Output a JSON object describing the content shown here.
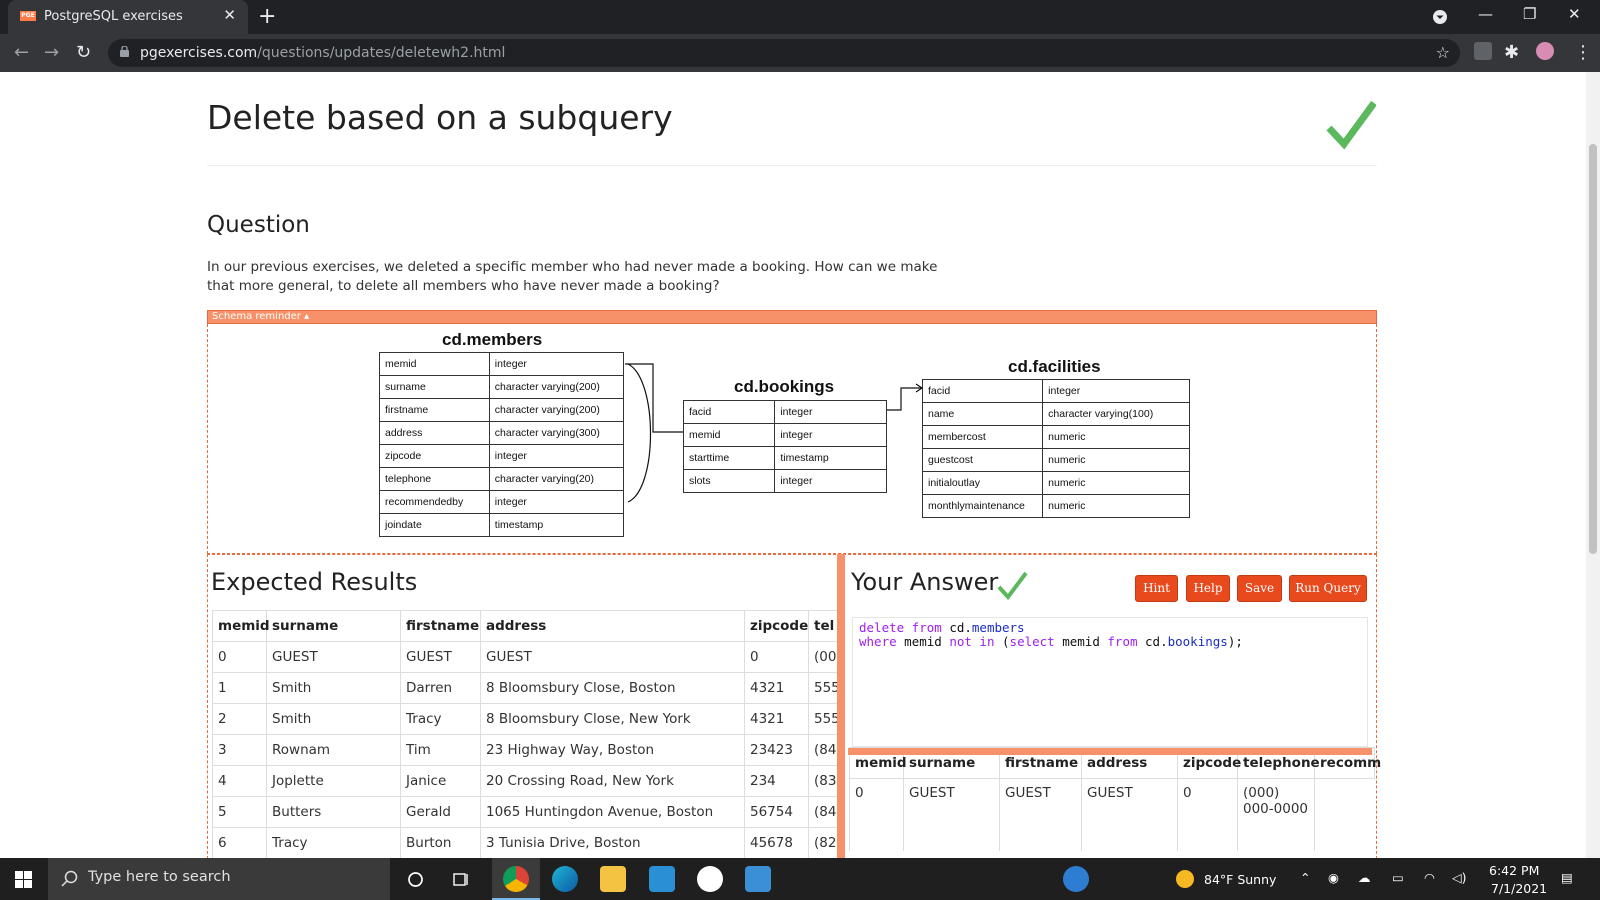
{
  "browser": {
    "tab_title": "PostgreSQL exercises",
    "favicon_text": "PGE",
    "url_domain": "pgexercises.com",
    "url_path": "/questions/updates/deletewh2.html"
  },
  "page": {
    "title": "Delete based on a subquery",
    "question_heading": "Question",
    "question_text": "In our previous exercises, we deleted a specific member who had never made a booking. How can we make that more general, to delete all members who have never made a booking?",
    "schema_toggle": "Schema reminder ▴"
  },
  "schema": {
    "members": {
      "title": "cd.members",
      "rows": [
        [
          "memid",
          "integer"
        ],
        [
          "surname",
          "character varying(200)"
        ],
        [
          "firstname",
          "character varying(200)"
        ],
        [
          "address",
          "character varying(300)"
        ],
        [
          "zipcode",
          "integer"
        ],
        [
          "telephone",
          "character varying(20)"
        ],
        [
          "recommendedby",
          "integer"
        ],
        [
          "joindate",
          "timestamp"
        ]
      ]
    },
    "bookings": {
      "title": "cd.bookings",
      "rows": [
        [
          "facid",
          "integer"
        ],
        [
          "memid",
          "integer"
        ],
        [
          "starttime",
          "timestamp"
        ],
        [
          "slots",
          "integer"
        ]
      ]
    },
    "facilities": {
      "title": "cd.facilities",
      "rows": [
        [
          "facid",
          "integer"
        ],
        [
          "name",
          "character varying(100)"
        ],
        [
          "membercost",
          "numeric"
        ],
        [
          "guestcost",
          "numeric"
        ],
        [
          "initialoutlay",
          "numeric"
        ],
        [
          "monthlymaintenance",
          "numeric"
        ]
      ]
    }
  },
  "expected": {
    "heading": "Expected Results",
    "columns": [
      "memid",
      "surname",
      "firstname",
      "address",
      "zipcode",
      "tel"
    ],
    "rows": [
      [
        "0",
        "GUEST",
        "GUEST",
        "GUEST",
        "0",
        "(00"
      ],
      [
        "1",
        "Smith",
        "Darren",
        "8 Bloomsbury Close, Boston",
        "4321",
        "555"
      ],
      [
        "2",
        "Smith",
        "Tracy",
        "8 Bloomsbury Close, New York",
        "4321",
        "555"
      ],
      [
        "3",
        "Rownam",
        "Tim",
        "23 Highway Way, Boston",
        "23423",
        "(84"
      ],
      [
        "4",
        "Joplette",
        "Janice",
        "20 Crossing Road, New York",
        "234",
        "(83"
      ],
      [
        "5",
        "Butters",
        "Gerald",
        "1065 Huntingdon Avenue, Boston",
        "56754",
        "(84"
      ],
      [
        "6",
        "Tracy",
        "Burton",
        "3 Tunisia Drive, Boston",
        "45678",
        "(82"
      ]
    ]
  },
  "answer": {
    "heading": "Your Answer",
    "buttons": {
      "hint": "Hint",
      "help": "Help",
      "save": "Save",
      "run": "Run Query"
    },
    "code": {
      "l1_kw1": "delete from",
      "l1_t1": " cd.",
      "l1_tbl": "members",
      "l2_kw1": "where",
      "l2_t1": " memid ",
      "l2_kw2": "not in",
      "l2_t2": " (",
      "l2_kw3": "select",
      "l2_t3": " memid ",
      "l2_kw4": "from",
      "l2_t4": " cd.",
      "l2_tbl": "bookings",
      "l2_t5": ");"
    },
    "columns": [
      "memid",
      "surname",
      "firstname",
      "address",
      "zipcode",
      "telephone",
      "recomm"
    ],
    "rows": [
      [
        "0",
        "GUEST",
        "GUEST",
        "GUEST",
        "0",
        "(000) 000-0000",
        ""
      ]
    ]
  },
  "taskbar": {
    "search_placeholder": "Type here to search",
    "weather": "84°F  Sunny",
    "time": "6:42 PM",
    "date": "7/1/2021"
  },
  "colors": {
    "accent": "#f79169",
    "button": "#e8491d",
    "check": "#5cb85c"
  }
}
